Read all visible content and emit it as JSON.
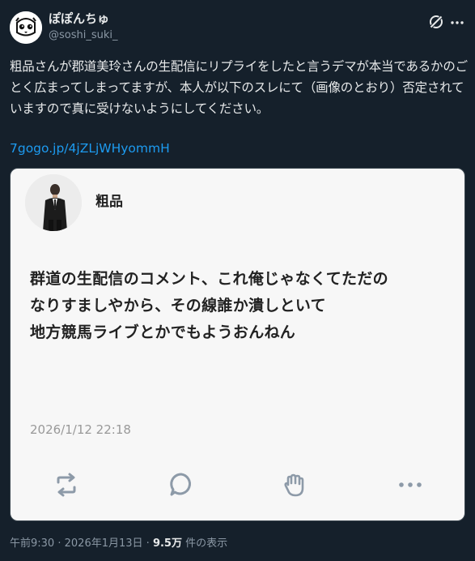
{
  "header": {
    "display_name": "ぽぽんちゅ",
    "handle": "@soshi_suki_",
    "grok_icon": "grok-icon",
    "more_icon": "more-icon"
  },
  "tweet": {
    "text": "粗品さんが郡道美玲さんの生配信にリプライをしたと言うデマが本当であるかのごとく広まってしまってますが、本人が以下のスレにて（画像のとおり）否定されていますので真に受けないようにしてください。",
    "link": "7gogo.jp/4jZLjWHyommH"
  },
  "card": {
    "name": "粗品",
    "body_lines": [
      "群道の生配信のコメント、これ俺じゃなくてただの",
      "なりすましやから、その線誰か潰しといて",
      "地方競馬ライブとかでもようおんねん"
    ],
    "timestamp": "2026/1/12 22:18",
    "actions": [
      "repost-icon",
      "comment-icon",
      "clap-icon",
      "more-icon"
    ]
  },
  "footer": {
    "time": "午前9:30",
    "separator": "·",
    "date": "2026年1月13日",
    "views_count": "9.5万",
    "views_label": "件の表示"
  },
  "colors": {
    "background": "#15202b",
    "text": "#e7e9ea",
    "secondary": "#8b98a5",
    "link": "#1d9bf0",
    "card_bg": "#f7f7f7"
  }
}
